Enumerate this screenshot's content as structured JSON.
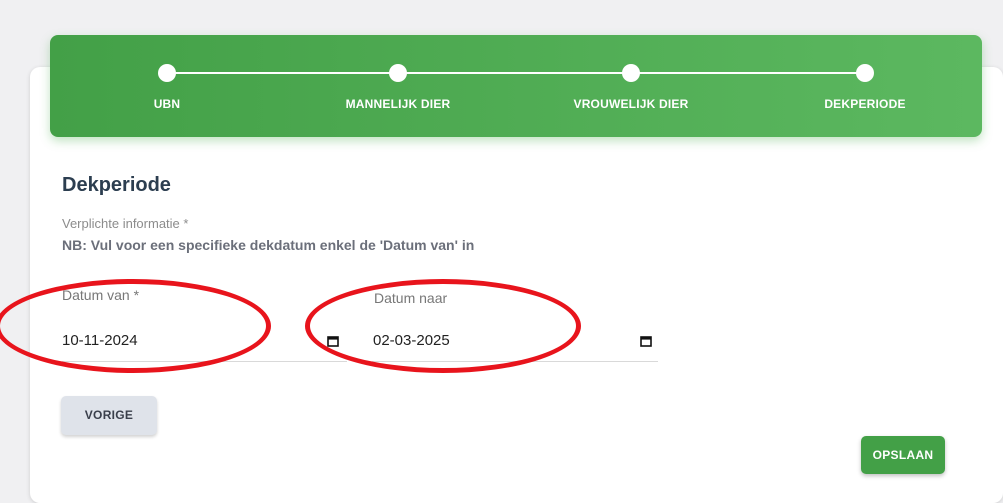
{
  "stepper": {
    "steps": [
      {
        "label": "UBN"
      },
      {
        "label": "MANNELIJK DIER"
      },
      {
        "label": "VROUWELIJK DIER"
      },
      {
        "label": "DEKPERIODE"
      }
    ]
  },
  "form": {
    "title": "Dekperiode",
    "required_note": "Verplichte informatie *",
    "nb_note": "NB: Vul voor een specifieke dekdatum enkel de 'Datum van' in",
    "date_from": {
      "label": "Datum van *",
      "value": "10-11-2024",
      "icon": "calendar-icon"
    },
    "date_to": {
      "label": "Datum naar",
      "value": "02-03-2025",
      "icon": "calendar-icon"
    }
  },
  "buttons": {
    "previous": "VORIGE",
    "save": "OPSLAAN"
  },
  "colors": {
    "stepper_green": "#43a047",
    "annotation_red": "#e8141c",
    "save_green": "#43a047",
    "previous_gray": "#dfe3ea"
  }
}
